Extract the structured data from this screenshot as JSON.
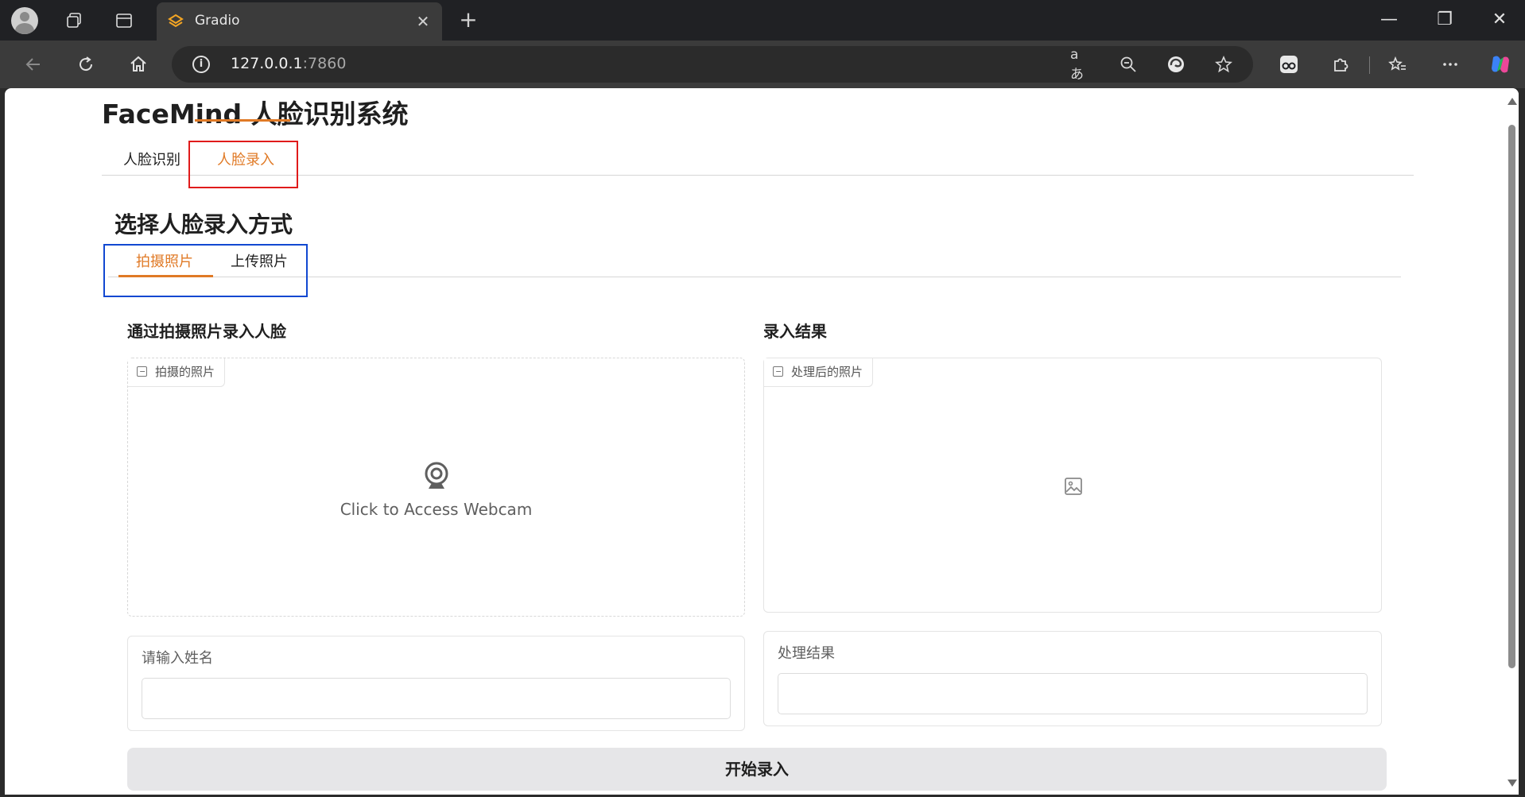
{
  "browser": {
    "tab_title": "Gradio",
    "url_host": "127.0.0.1",
    "url_port": ":7860",
    "new_tab_glyph": "+",
    "close_tab_glyph": "✕",
    "window_controls": {
      "minimize": "—",
      "restore": "❐",
      "close": "✕"
    },
    "read_aloud_glyph": "aあ"
  },
  "app": {
    "title": "FaceMind 人脸识别系统",
    "main_tabs": [
      {
        "label": "人脸识别",
        "active": false
      },
      {
        "label": "人脸录入",
        "active": true
      }
    ]
  },
  "enroll": {
    "section_title": "选择人脸录入方式",
    "sub_tabs": [
      {
        "label": "拍摄照片",
        "active": true
      },
      {
        "label": "上传照片",
        "active": false
      }
    ],
    "left": {
      "title": "通过拍摄照片录入人脸",
      "image_label": "拍摄的照片",
      "webcam_prompt": "Click to Access Webcam",
      "name_label": "请输入姓名",
      "name_value": ""
    },
    "right": {
      "title": "录入结果",
      "image_label": "处理后的照片",
      "result_label": "处理结果",
      "result_value": ""
    },
    "submit_label": "开始录入"
  },
  "colors": {
    "accent": "#e07a26",
    "highlight_red": "#e01b1b",
    "highlight_blue": "#1148d1"
  }
}
